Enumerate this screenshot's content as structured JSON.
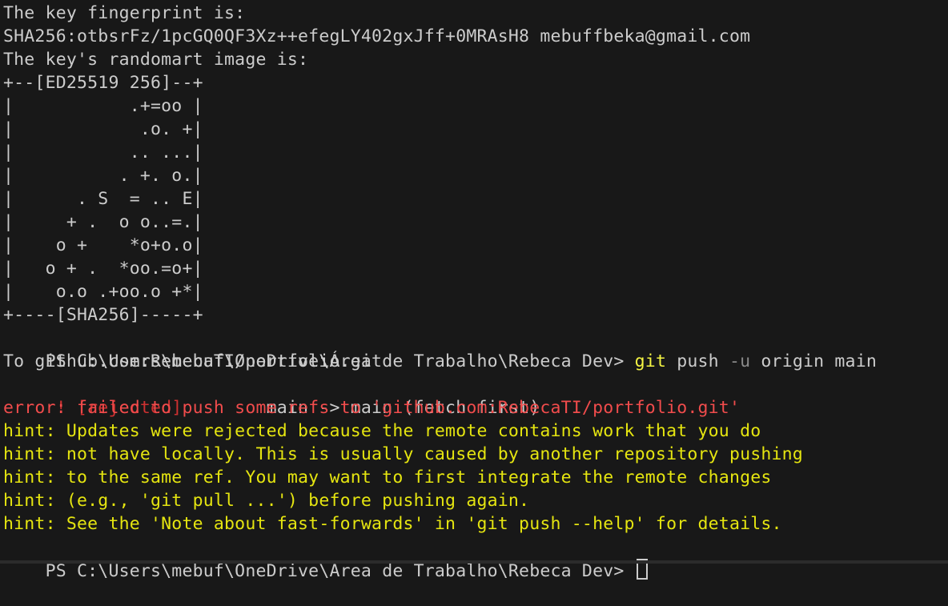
{
  "colors": {
    "background": "#181818",
    "default_text": "#cccccc",
    "error_text": "#f14c4c",
    "rejected_text": "#cd3131",
    "hint_text": "#e5e510",
    "command_highlight": "#f5f543",
    "flag_text": "#8a8a8a"
  },
  "terminal": {
    "fingerprint_header": "The key fingerprint is:",
    "fingerprint": "SHA256:otbsrFz/1pcGQ0QF3Xz++efegLY402gxJff+0MRAsH8 mebuffbeka@gmail.com",
    "randomart_header": "The key's randomart image is:",
    "randomart": [
      "+--[ED25519 256]--+",
      "|           .+=oo |",
      "|            .o. +|",
      "|           .. ...|",
      "|          . +. o.|",
      "|      . S  = .. E|",
      "|     + .  o o..=.|",
      "|    o +    *o+o.o|",
      "|   o + .  *oo.=o+|",
      "|    o.o .+oo.o +*|",
      "+----[SHA256]-----+"
    ],
    "prompt": "PS C:\\Users\\mebuf\\OneDrive\\Área de Trabalho\\Rebeca Dev> ",
    "command": {
      "program": "git",
      "args_before_flag": " push ",
      "flag": "-u",
      "args_after_flag": " origin main"
    },
    "push_target": "To github.com:RebecaTI/portfolio.git",
    "rejected": {
      "marker": " ! [rejected]",
      "detail": "        main -> main (fetch first)"
    },
    "error": "error: failed to push some refs to 'github.com:RebecaTI/portfolio.git'",
    "hints": [
      "hint: Updates were rejected because the remote contains work that you do",
      "hint: not have locally. This is usually caused by another repository pushing",
      "hint: to the same ref. You may want to first integrate the remote changes",
      "hint: (e.g., 'git pull ...') before pushing again.",
      "hint: See the 'Note about fast-forwards' in 'git push --help' for details."
    ],
    "final_prompt": "PS C:\\Users\\mebuf\\OneDrive\\Área de Trabalho\\Rebeca Dev> ",
    "input_value": ""
  }
}
